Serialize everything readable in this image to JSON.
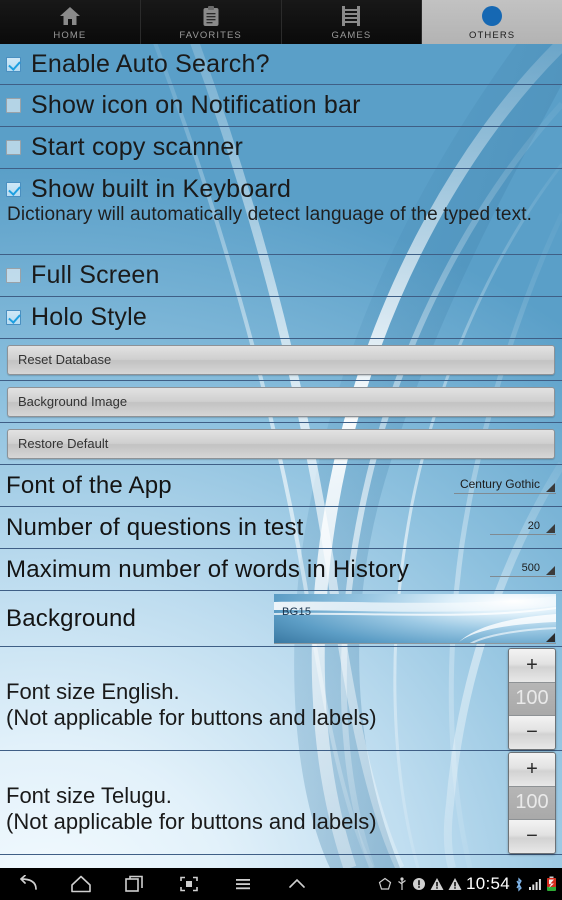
{
  "tabs": [
    {
      "label": "HOME",
      "icon": "home-icon",
      "selected": false
    },
    {
      "label": "FAVORITES",
      "icon": "clipboard-icon",
      "selected": false
    },
    {
      "label": "GAMES",
      "icon": "abacus-icon",
      "selected": false
    },
    {
      "label": "OTHERS",
      "icon": "pie-circle-icon",
      "selected": true
    }
  ],
  "checkboxes": [
    {
      "label": "Enable Auto Search?",
      "checked": true
    },
    {
      "label": "Show icon on Notification bar",
      "checked": false
    },
    {
      "label": "Start copy scanner",
      "checked": false
    },
    {
      "label": "Show built in Keyboard",
      "checked": true,
      "summary": "Dictionary will automatically detect language of the typed text."
    },
    {
      "label": "Full Screen",
      "checked": false
    },
    {
      "label": "Holo Style",
      "checked": true
    }
  ],
  "buttons": [
    {
      "label": "Reset Database"
    },
    {
      "label": "Background Image"
    },
    {
      "label": "Restore Default"
    }
  ],
  "spinners": [
    {
      "title": "Font of the App",
      "value": "Century Gothic"
    },
    {
      "title": "Number of questions in test",
      "value": "20"
    },
    {
      "title": "Maximum number of words in History",
      "value": "500"
    }
  ],
  "background_pref": {
    "title": "Background",
    "value": "BG15"
  },
  "font_sizes": [
    {
      "line1": "Font size English.",
      "line2": "(Not applicable for buttons and labels)",
      "value": "100",
      "plus": "+",
      "minus": "−"
    },
    {
      "line1": "Font size Telugu.",
      "line2": "(Not applicable for buttons and labels)",
      "value": "100",
      "plus": "+",
      "minus": "−"
    }
  ],
  "navbar": {
    "buttons": [
      {
        "icon": "back-icon"
      },
      {
        "icon": "home-icon"
      },
      {
        "icon": "recents-icon"
      },
      {
        "icon": "screenshot-icon"
      },
      {
        "icon": "menu-icon"
      },
      {
        "icon": "chevron-up-icon"
      }
    ],
    "status_icons": [
      "pentagon-outline-icon",
      "usb-icon",
      "alert-circle-icon",
      "warning-triangle-icon",
      "warning-triangle-icon"
    ],
    "clock": "10:54",
    "right_icons": [
      "bluetooth-icon",
      "signal-bars-icon",
      "battery-icon"
    ]
  },
  "colors": {
    "accent": "#1e9fe0",
    "divider": "#3f5f86",
    "tab_selected_bg": "#b9b9b9",
    "nav_bg": "#000000"
  }
}
